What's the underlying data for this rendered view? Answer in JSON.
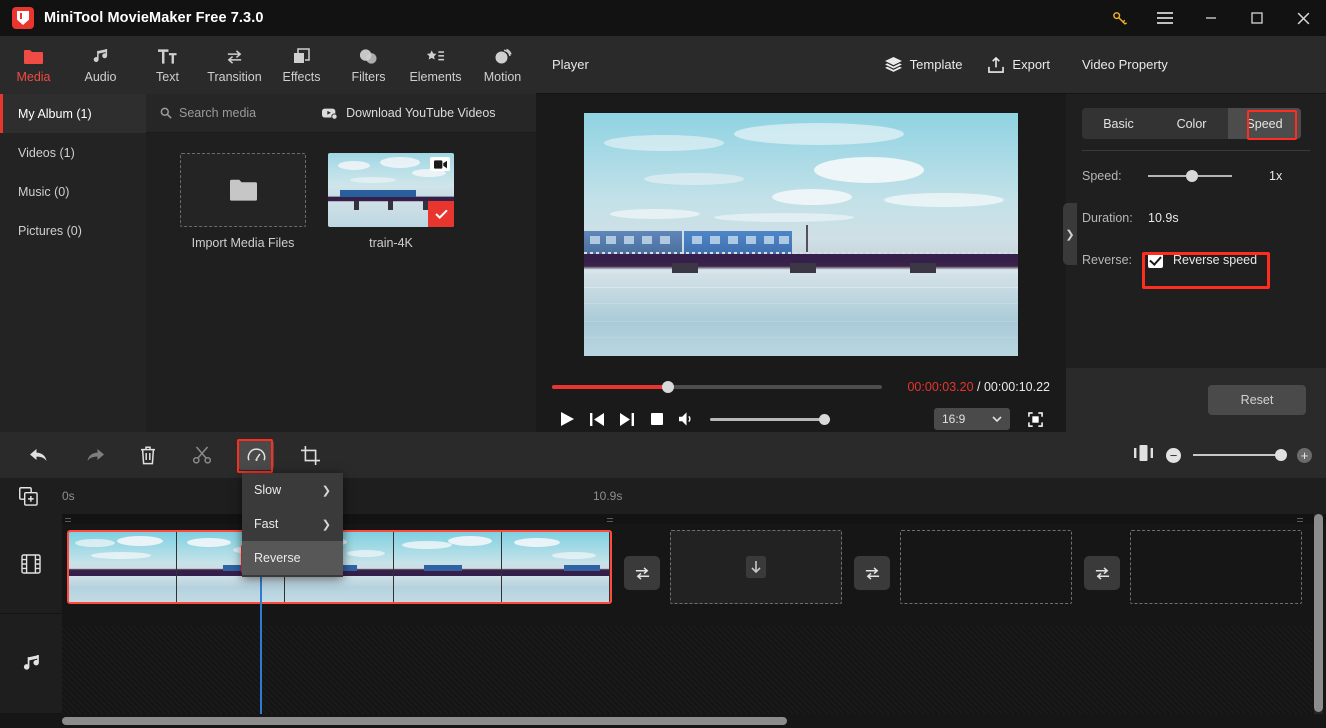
{
  "window": {
    "title": "MiniTool MovieMaker Free 7.3.0",
    "controls": {
      "key": "key-icon",
      "menu": "menu-icon",
      "minimize": "—",
      "maximize": "▢",
      "close": "✕"
    }
  },
  "tabbar": [
    {
      "label": "Media",
      "icon": "folder-icon",
      "active": true
    },
    {
      "label": "Audio",
      "icon": "music-note-icon",
      "active": false
    },
    {
      "label": "Text",
      "icon": "text-icon",
      "active": false
    },
    {
      "label": "Transition",
      "icon": "transition-arrows-icon",
      "active": false
    },
    {
      "label": "Effects",
      "icon": "layers-square-icon",
      "active": false
    },
    {
      "label": "Filters",
      "icon": "droplets-icon",
      "active": false
    },
    {
      "label": "Elements",
      "icon": "star-list-icon",
      "active": false
    },
    {
      "label": "Motion",
      "icon": "motion-sphere-icon",
      "active": false
    }
  ],
  "album": {
    "items": [
      {
        "label": "My Album (1)",
        "active": true
      },
      {
        "label": "Videos (1)",
        "active": false
      },
      {
        "label": "Music (0)",
        "active": false
      },
      {
        "label": "Pictures (0)",
        "active": false
      }
    ]
  },
  "media": {
    "search_placeholder": "Search media",
    "download_label": "Download YouTube Videos",
    "import_label": "Import Media Files",
    "asset_label": "train-4K"
  },
  "player": {
    "title": "Player",
    "template_label": "Template",
    "export_label": "Export",
    "current_time": "00:00:03.20",
    "separator": " / ",
    "total_time": "00:00:10.22",
    "aspect_ratio": "16:9",
    "progress_percent": 33,
    "volume_percent": 100
  },
  "property": {
    "title": "Video Property",
    "tabs": [
      {
        "label": "Basic",
        "active": false
      },
      {
        "label": "Color",
        "active": false
      },
      {
        "label": "Speed",
        "active": true
      }
    ],
    "speed_label": "Speed:",
    "speed_value": "1x",
    "duration_label": "Duration:",
    "duration_value": "10.9s",
    "reverse_label": "Reverse:",
    "reverse_checkbox_label": "Reverse speed",
    "reverse_checked": true,
    "reset_label": "Reset",
    "collapse_chevron": "❯"
  },
  "timeline": {
    "tools": [
      {
        "name": "undo",
        "icon": "undo-arrow-icon"
      },
      {
        "name": "redo",
        "icon": "redo-arrow-icon"
      },
      {
        "name": "delete",
        "icon": "trash-icon"
      },
      {
        "name": "split",
        "icon": "scissors-icon"
      },
      {
        "name": "speed",
        "icon": "speedometer-icon",
        "pressed": true
      },
      {
        "name": "crop",
        "icon": "crop-icon"
      }
    ],
    "ruler": {
      "start": "0s",
      "end": "10.9s"
    },
    "tracks": [
      {
        "name": "video-track",
        "icon": "film-strip-icon"
      },
      {
        "name": "audio-track",
        "icon": "music-note-icon"
      }
    ],
    "zoom": {
      "minus": "−",
      "plus": "+",
      "value": 100
    }
  },
  "speed_menu": {
    "items": [
      {
        "label": "Slow",
        "has_submenu": true,
        "arrow": "❯",
        "highlighted": false
      },
      {
        "label": "Fast",
        "has_submenu": true,
        "arrow": "❯",
        "highlighted": false
      },
      {
        "label": "Reverse",
        "has_submenu": false,
        "arrow": "",
        "highlighted": true
      }
    ]
  },
  "colors": {
    "accent_red": "#e8352e",
    "highlight_red": "#ff2d20",
    "playhead_blue": "#2f7bd4",
    "panel_bg": "#1f1f1f",
    "toolbar_bg": "#2a2a2a"
  }
}
